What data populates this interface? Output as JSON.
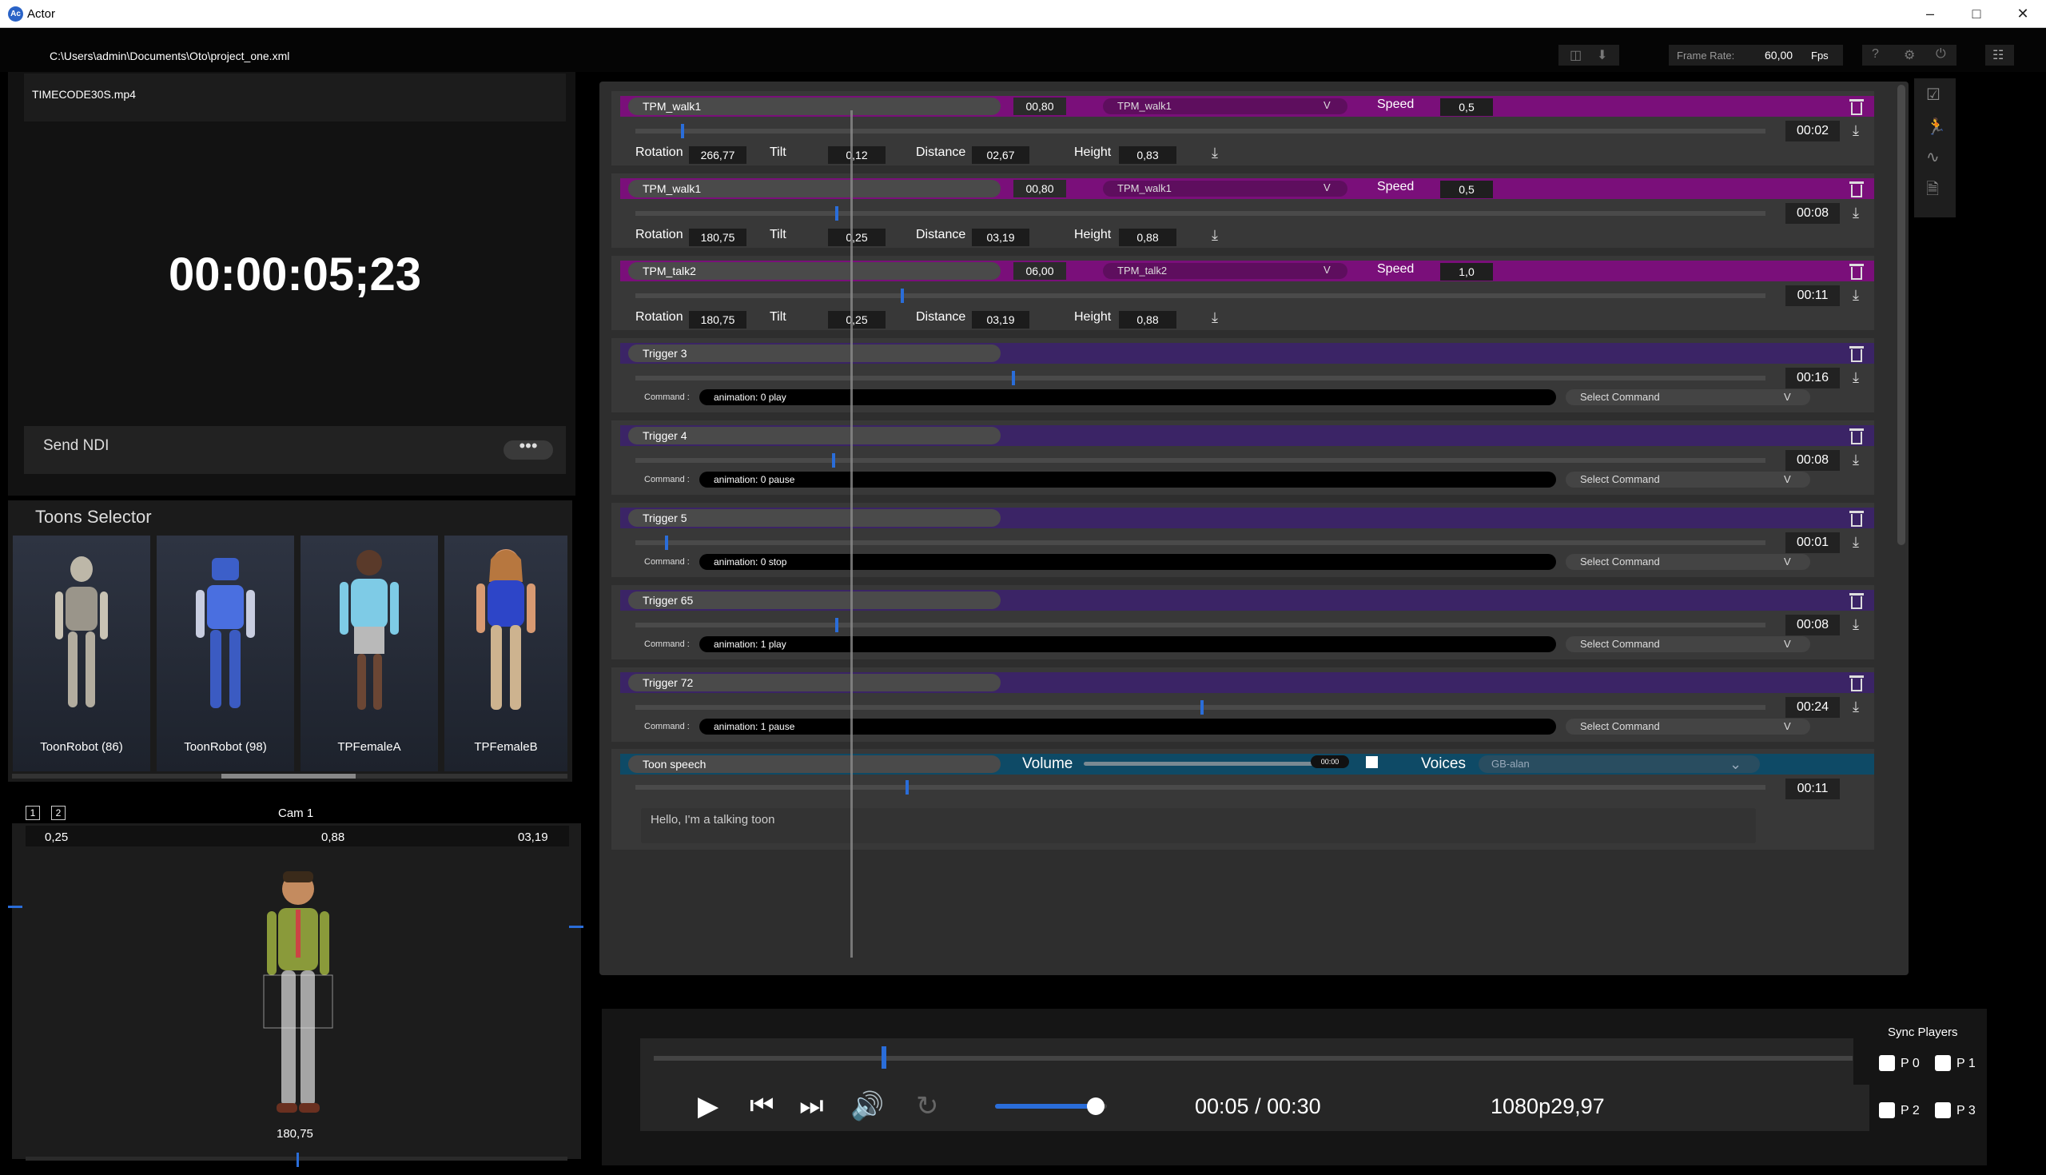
{
  "window": {
    "title": "Actor"
  },
  "project_path": "C:\\Users\\admin\\Documents\\Oto\\project_one.xml",
  "toolbar": {
    "frame_rate_label": "Frame Rate:",
    "frame_rate_value": "60,00",
    "fps_label": "Fps"
  },
  "media": {
    "filename": "TIMECODE30S.mp4",
    "timecode": "00:00:05;23",
    "send_ndi_label": "Send NDI",
    "more_label": "•••"
  },
  "toons_selector": {
    "title": "Toons Selector",
    "items": [
      {
        "name": "ToonRobot (86)"
      },
      {
        "name": "ToonRobot (98)"
      },
      {
        "name": "TPFemaleA"
      },
      {
        "name": "TPFemaleB"
      }
    ]
  },
  "camera": {
    "tab1": "1",
    "tab2": "2",
    "title": "Cam 1",
    "left_value": "0,25",
    "center_value": "0,88",
    "right_value": "03,19",
    "bottom_value": "180,75"
  },
  "walk_rows": [
    {
      "name": "TPM_walk1",
      "value": "00,80",
      "anim": "TPM_walk1",
      "speed_label": "Speed",
      "speed": "0,5",
      "time": "00:02",
      "rotation": "266,77",
      "tilt": "0,12",
      "distance": "02,67",
      "height": "0,83",
      "marker": 0.04
    },
    {
      "name": "TPM_walk1",
      "value": "00,80",
      "anim": "TPM_walk1",
      "speed_label": "Speed",
      "speed": "0,5",
      "time": "00:08",
      "rotation": "180,75",
      "tilt": "0,25",
      "distance": "03,19",
      "height": "0,88",
      "marker": 0.177
    },
    {
      "name": "TPM_talk2",
      "value": "06,00",
      "anim": "TPM_talk2",
      "speed_label": "Speed",
      "speed": "1,0",
      "time": "00:11",
      "rotation": "180,75",
      "tilt": "0,25",
      "distance": "03,19",
      "height": "0,88",
      "marker": 0.235
    }
  ],
  "labels": {
    "rotation": "Rotation",
    "tilt": "Tilt",
    "distance": "Distance",
    "height": "Height",
    "command": "Command :",
    "select_command": "Select Command",
    "chevron": "V"
  },
  "trigger_rows": [
    {
      "name": "Trigger 3",
      "time": "00:16",
      "command": "animation: 0 play",
      "marker": 0.333
    },
    {
      "name": "Trigger 4",
      "time": "00:08",
      "command": "animation: 0 pause",
      "marker": 0.174
    },
    {
      "name": "Trigger 5",
      "time": "00:01",
      "command": "animation: 0 stop",
      "marker": 0.026
    },
    {
      "name": "Trigger 65",
      "time": "00:08",
      "command": "animation: 1 play",
      "marker": 0.177
    },
    {
      "name": "Trigger 72",
      "time": "00:24",
      "command": "animation: 1 pause",
      "marker": 0.5
    }
  ],
  "speech_row": {
    "name": "Toon speech",
    "volume_label": "Volume",
    "volume_time": "00:00",
    "voices_label": "Voices",
    "voice": "GB-alan",
    "time": "00:11",
    "text": "Hello, I'm a talking toon",
    "marker": 0.239
  },
  "player": {
    "time": "00:05 / 00:30",
    "format": "1080p29,97",
    "progress": 0.19,
    "volume": 0.9,
    "sync_label": "Sync Players",
    "p0": "P 0",
    "p1": "P 1",
    "p2": "P 2",
    "p3": "P 3"
  }
}
